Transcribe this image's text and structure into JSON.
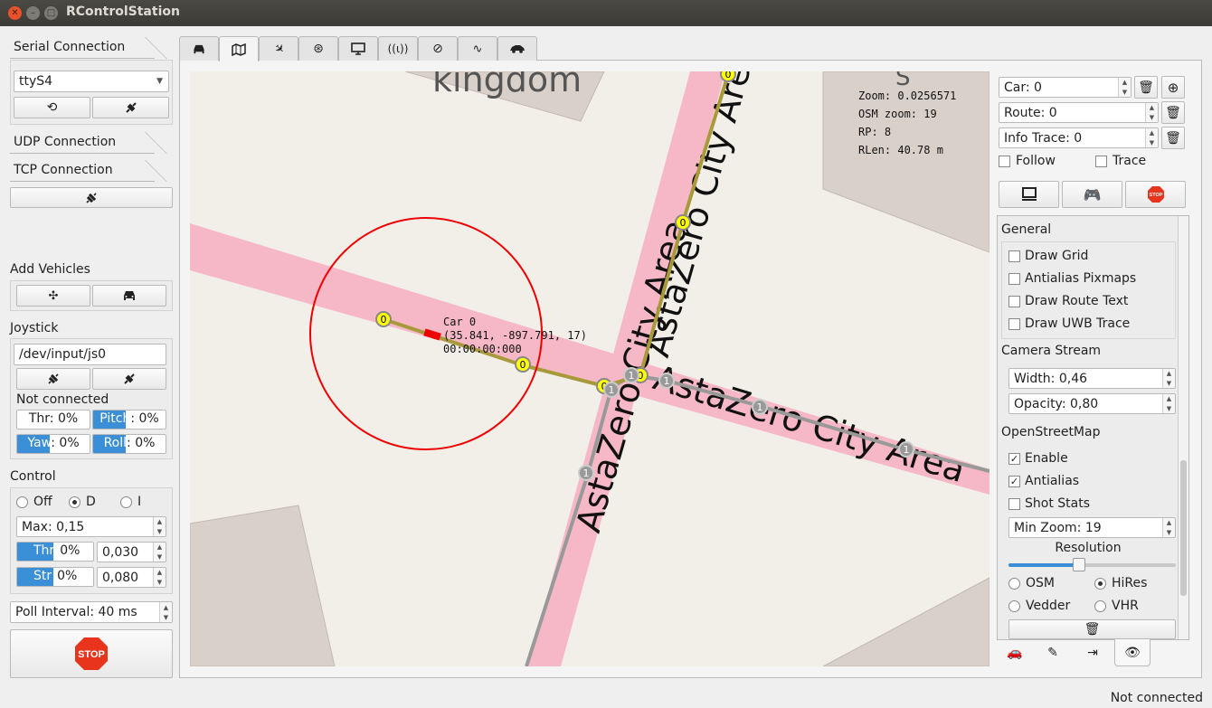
{
  "window": {
    "title": "RControlStation"
  },
  "left_panel": {
    "serial_tab": "Serial Connection",
    "serial_port": "ttyS4",
    "udp_tab": "UDP Connection",
    "tcp_tab": "TCP Connection",
    "add_vehicles_label": "Add Vehicles",
    "joystick_label": "Joystick",
    "joystick_device": "/dev/input/js0",
    "joystick_status": "Not connected",
    "thr": {
      "label": "Thr",
      "value": "0%",
      "level": 0.0
    },
    "pitch": {
      "label": "Pitch",
      "value": "0%",
      "level": 0.45
    },
    "yaw": {
      "label": "Yaw",
      "value": "0%",
      "level": 0.45
    },
    "roll": {
      "label": "Roll",
      "value": "0%",
      "level": 0.45
    },
    "control_label": "Control",
    "control_modes": [
      "Off",
      "D",
      "I"
    ],
    "control_selected": "D",
    "max_field": "Max: 0,15",
    "ctrl_thr": {
      "label": "Thr",
      "value": "0%",
      "extra": "0,030",
      "level": 0.45
    },
    "ctrl_str": {
      "label": "Str",
      "value": "0%",
      "extra": "0,080",
      "level": 0.45
    },
    "poll_interval": "Poll Interval: 40 ms",
    "stop_label": "STOP"
  },
  "main_tabs": [
    "car-icon",
    "map-icon",
    "satellite-icon",
    "nav-icon",
    "screen-icon",
    "antenna-icon",
    "compass-icon",
    "signal-icon",
    "car-side-icon"
  ],
  "map": {
    "info": {
      "zoom": "Zoom: 0.0256571",
      "osm_zoom": "OSM zoom: 19",
      "rp": "RP: 8",
      "rlen": "RLen: 40.78 m"
    },
    "car_label_name": "Car 0",
    "car_label_pos": "(35.841, -897.791, 17)",
    "car_label_time": "00:00:00:000",
    "street_labels": [
      "kingdom",
      "AstaZero City Area",
      "AstaZero City Area",
      "AstaZero City Area"
    ],
    "point_label_yellow": "0",
    "point_label_gray": "1",
    "building_letter": "S"
  },
  "right_panel": {
    "car_field": "Car: 0",
    "route_field": "Route: 0",
    "info_trace_field": "Info Trace: 0",
    "follow_label": "Follow",
    "trace_label": "Trace",
    "general_header": "General",
    "general_options": [
      "Draw Grid",
      "Antialias Pixmaps",
      "Draw Route Text",
      "Draw UWB Trace"
    ],
    "camera_header": "Camera Stream",
    "width_field": "Width: 0,46",
    "opacity_field": "Opacity: 0,80",
    "osm_header": "OpenStreetMap",
    "osm_options": [
      {
        "label": "Enable",
        "checked": true
      },
      {
        "label": "Antialias",
        "checked": true
      },
      {
        "label": "Shot Stats",
        "checked": false
      }
    ],
    "min_zoom_field": "Min Zoom: 19",
    "resolution_label": "Resolution",
    "resolution_level": 0.42,
    "tile_sources": [
      "OSM",
      "HiRes",
      "Vedder",
      "VHR"
    ],
    "tile_selected": "HiRes",
    "stop_small": "STOP"
  },
  "status_bar": {
    "text": "Not connected"
  },
  "colors": {
    "accent": "#3b8fd6",
    "road": "#f6b8c6",
    "route": "#a89a3a",
    "stop": "#e8341c"
  }
}
